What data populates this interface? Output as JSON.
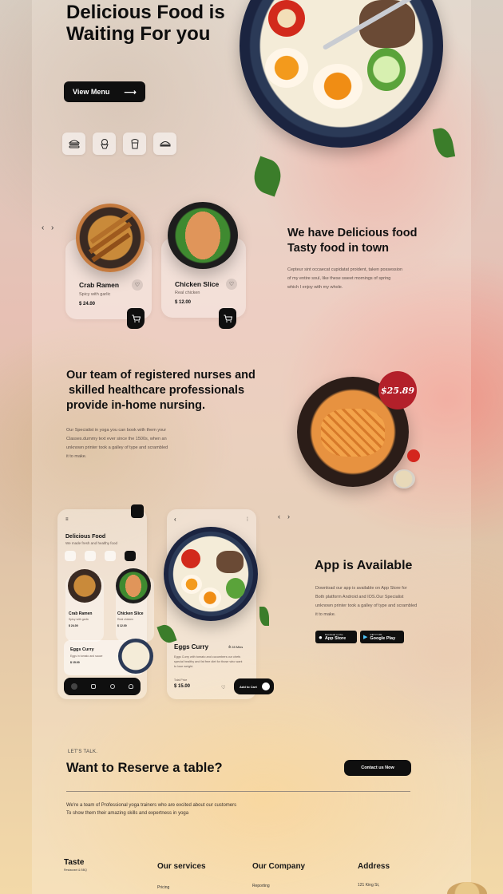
{
  "hero": {
    "title": "Delicious Food is Waiting For you",
    "view_menu": "View Menu",
    "arrow": "⟶",
    "categories": [
      {
        "icon": "burger-icon"
      },
      {
        "icon": "ice-cream-icon"
      },
      {
        "icon": "drink-icon"
      },
      {
        "icon": "dish-icon"
      }
    ]
  },
  "carousel": {
    "prev": "‹",
    "next": "›",
    "cards": [
      {
        "title": "Crab Ramen",
        "subtitle": "Spicy with garlic",
        "price": "$ 24.00"
      },
      {
        "title": "Chicken Slice",
        "subtitle": "Real chicken",
        "price": "$ 12.00"
      }
    ]
  },
  "about": {
    "heading_line1": "We have Delicious food",
    "heading_line2": "Tasty food in town",
    "paragraph_line1": "Cepteur sint occaecat cupidatat proident, taken possession",
    "paragraph_line2": "of my entire soul, like these sweet mornings of spring",
    "paragraph_line3": "which I enjoy with my whole."
  },
  "team": {
    "heading_line1": "Our team of registered nurses and",
    "heading_line2": "skilled healthcare professionals",
    "heading_line3": "provide in-home nursing.",
    "paragraph_line1": "Our Specialist in yoga you can book with them your",
    "paragraph_line2": "Classes.dummy text ever since the 1500s, when an",
    "paragraph_line3": "unknown printer took a galley of type and scrambled",
    "paragraph_line4": "it to make.",
    "price_badge": "$25.89"
  },
  "app_mock": {
    "menu_title": "Delicious Food",
    "menu_sub": "We made fresh and healthy food",
    "cards": [
      {
        "title": "Crab Ramen",
        "subtitle": "Spicy with garlic",
        "price": "$ 24.00"
      },
      {
        "title": "Chicken Slice",
        "subtitle": "Real chicken",
        "price": "$ 12.00"
      }
    ],
    "eggs_title": "Eggs Curry",
    "eggs_sub": "Eggs in tomato and sauce",
    "eggs_price": "$ 15.00",
    "detail_title": "Eggs Curry",
    "detail_time": "28 Mins",
    "detail_desc_line1": "Eggs Curry with tomato and cucumbers our chefs",
    "detail_desc_line2": "special healthy and fat free diet for those who want",
    "detail_desc_line3": "to lose weight.",
    "total_label": "Total Price",
    "total_price": "$ 15.00",
    "add_to_cart": "Add to Cart",
    "back": "‹",
    "more": "⋮"
  },
  "app_section": {
    "heading": "App is Available",
    "paragraph_line1": "Download our app is available  on App Store  for",
    "paragraph_line2": "Both platform Android and IOS.Our Specialist",
    "paragraph_line3": "unknown printer took a galley of type and scrambled",
    "paragraph_line4": "it to make.",
    "appstore_small": "Download on the",
    "appstore_big": "App Store",
    "googleplay_small": "GET IT ON",
    "googleplay_big": "Google Play"
  },
  "reserve": {
    "kicker": "LET'S TALK.",
    "heading": "Want to Reserve a table?",
    "contact_button": "Contact us Now",
    "paragraph_line1": "We're a team of Professional yoga trainers who are excited about our customers",
    "paragraph_line2": "To show them their amazing skills and expertness in yoga"
  },
  "footer": {
    "brand": "Taste",
    "brand_sub": "Restaurant & BBQ",
    "col1_title": "Our services",
    "col1_item": "Pricing",
    "col2_title": "Our Company",
    "col2_item": "Reporting",
    "col3_title": "Address",
    "col3_item": "121 King St,"
  }
}
